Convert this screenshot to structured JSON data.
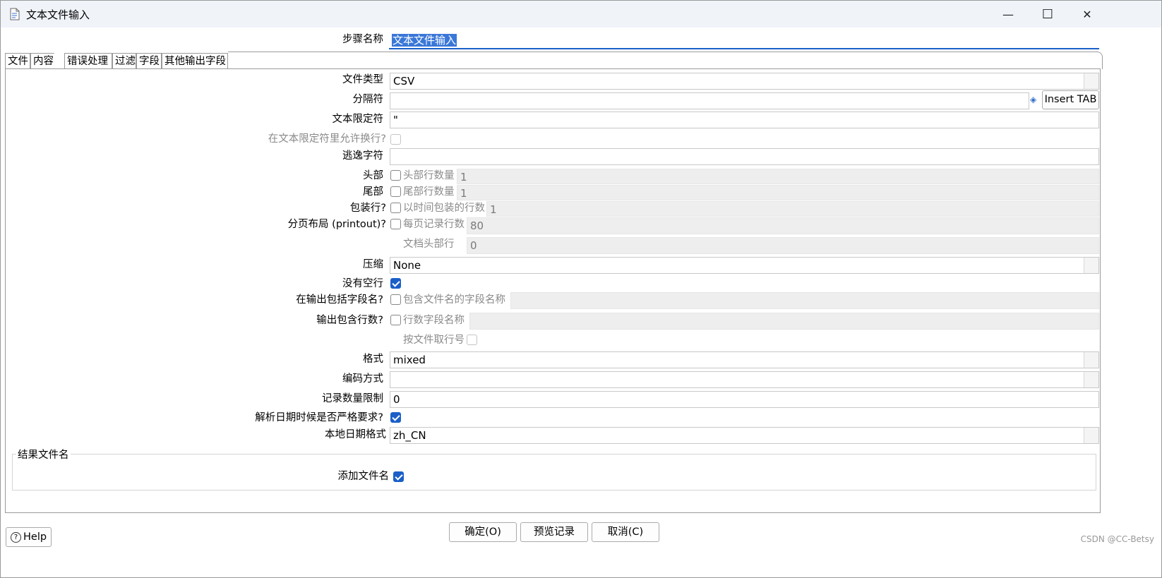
{
  "window": {
    "title": "文本文件输入",
    "minimize": "—",
    "maximize": "☐",
    "close": "✕"
  },
  "step_name": {
    "label": "步骤名称",
    "value": "文本文件输入"
  },
  "tabs": [
    {
      "label": "文件"
    },
    {
      "label": "内容"
    },
    {
      "label": "错误处理"
    },
    {
      "label": "过滤"
    },
    {
      "label": "字段"
    },
    {
      "label": "其他输出字段"
    }
  ],
  "active_tab": "内容",
  "content": {
    "file_type": {
      "label": "文件类型",
      "value": "CSV"
    },
    "separator": {
      "label": "分隔符",
      "value": "",
      "insert_tab": "Insert TAB"
    },
    "enclosure": {
      "label": "文本限定符",
      "value": "\""
    },
    "allow_breaks": {
      "label": "在文本限定符里允许换行?",
      "checked": false
    },
    "escape": {
      "label": "逃逸字符",
      "value": ""
    },
    "header": {
      "label": "头部",
      "checked": false,
      "sub_label": "头部行数量",
      "value": "1"
    },
    "footer": {
      "label": "尾部",
      "checked": false,
      "sub_label": "尾部行数量",
      "value": "1"
    },
    "wrap": {
      "label": "包装行?",
      "checked": false,
      "sub_label": "以时间包装的行数",
      "value": "1"
    },
    "paged": {
      "label": "分页布局 (printout)?",
      "checked": false,
      "sub_label": "每页记录行数",
      "value": "80"
    },
    "doc_header": {
      "sub_label": "文档头部行",
      "value": "0"
    },
    "compression": {
      "label": "压缩",
      "value": "None"
    },
    "no_empty": {
      "label": "没有空行",
      "checked": true
    },
    "include_filename": {
      "label": "在输出包括字段名?",
      "checked": false,
      "sub_label": "包含文件名的字段名称",
      "value": ""
    },
    "include_rownum": {
      "label": "输出包含行数?",
      "checked": false,
      "sub_label": "行数字段名称",
      "value": ""
    },
    "rownum_by_file": {
      "sub_label": "按文件取行号",
      "checked": false
    },
    "format": {
      "label": "格式",
      "value": "mixed"
    },
    "encoding": {
      "label": "编码方式",
      "value": ""
    },
    "limit": {
      "label": "记录数量限制",
      "value": "0"
    },
    "strict_date": {
      "label": "解析日期时候是否严格要求?",
      "checked": true
    },
    "locale": {
      "label": "本地日期格式",
      "value": "zh_CN"
    }
  },
  "result_group": {
    "title": "结果文件名",
    "add_label": "添加文件名",
    "checked": true
  },
  "buttons": {
    "help": "Help",
    "ok": "确定(O)",
    "preview": "预览记录",
    "cancel": "取消(C)"
  },
  "watermark": "CSDN @CC-Betsy"
}
